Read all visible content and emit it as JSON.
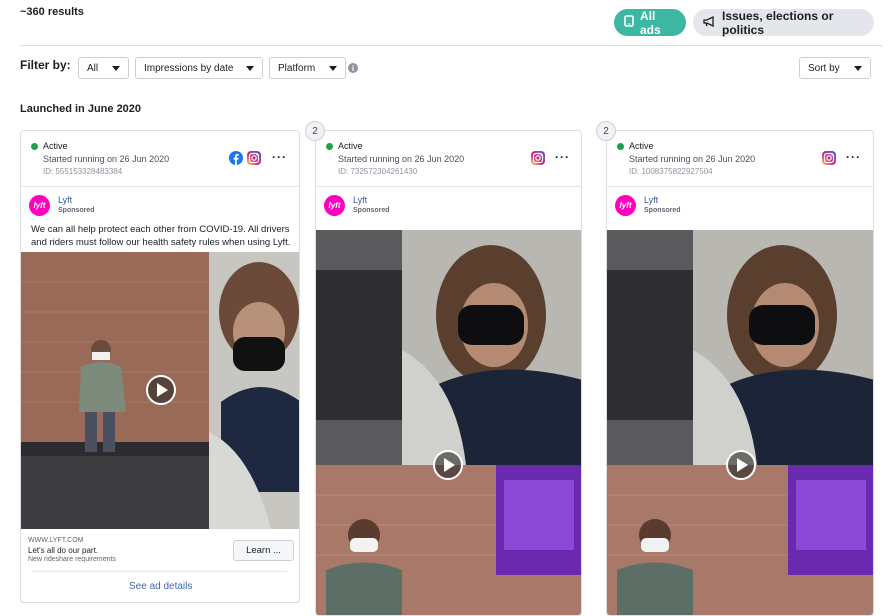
{
  "header": {
    "results": "~360 results",
    "all_ads": "All ads",
    "issues": "Issues, elections or politics"
  },
  "filters": {
    "label": "Filter by:",
    "all": "All",
    "impressions": "Impressions by date",
    "platform": "Platform",
    "sort": "Sort by"
  },
  "section": "Launched in June 2020",
  "cards": [
    {
      "status": "Active",
      "started": "Started running on 26 Jun 2020",
      "id": "ID: 555153328483384",
      "advertiser": "Lyft",
      "sponsored": "Sponsored",
      "text": "We can all help protect each other from COVID-19. All drivers and riders must follow our health safety rules when using Lyft.",
      "domain": "WWW.LYFT.COM",
      "headline": "Let's all do our part.",
      "desc": "New rideshare requirements",
      "cta": "Learn ...",
      "details": "See ad details"
    },
    {
      "badge": "2",
      "status": "Active",
      "started": "Started running on 26 Jun 2020",
      "id": "ID: 732572304261430",
      "advertiser": "Lyft",
      "sponsored": "Sponsored"
    },
    {
      "badge": "2",
      "status": "Active",
      "started": "Started running on 26 Jun 2020",
      "id": "ID: 1008375822927504",
      "advertiser": "Lyft",
      "sponsored": "Sponsored"
    }
  ],
  "logo_text": "lyft",
  "icons": [
    "tablet-icon",
    "megaphone-icon",
    "info-icon",
    "facebook-icon",
    "instagram-icon",
    "more-icon",
    "play-icon"
  ],
  "colors": {
    "accent": "#3cb7a1",
    "active": "#1aa34a",
    "lyft": "#ff00bf",
    "link": "#4267b2"
  }
}
